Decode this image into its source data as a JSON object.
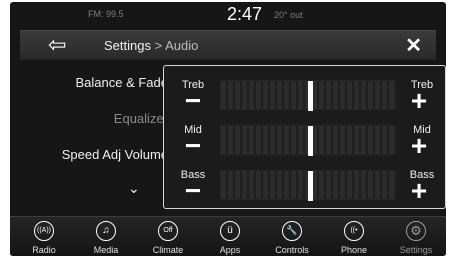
{
  "status": {
    "radio": "FM: 99.5",
    "time": "2:47",
    "temp": "20° out"
  },
  "header": {
    "back_icon": "back-arrow-icon",
    "title_section": "Settings",
    "title_sep": ">",
    "title_page": "Audio",
    "close_icon": "close-icon"
  },
  "menu": {
    "items": [
      {
        "label": "Balance & Fade",
        "active": true
      },
      {
        "label": "Equalizer",
        "active": false
      },
      {
        "label": "Speed Adj Volume",
        "active": true
      }
    ],
    "more_icon": "chevron-down-icon"
  },
  "equalizer": {
    "bands": [
      {
        "left_label": "Treb",
        "right_label": "Treb",
        "minus": "−",
        "plus": "+",
        "level": 0
      },
      {
        "left_label": "Mid",
        "right_label": "Mid",
        "minus": "−",
        "plus": "+",
        "level": 0
      },
      {
        "left_label": "Bass",
        "right_label": "Bass",
        "minus": "−",
        "plus": "+",
        "level": 0
      }
    ]
  },
  "navbar": {
    "items": [
      {
        "label": "Radio",
        "icon": "radio-icon",
        "glyph": "((A))"
      },
      {
        "label": "Media",
        "icon": "music-note-icon",
        "glyph": "♫"
      },
      {
        "label": "Climate",
        "icon": "climate-off-icon",
        "glyph": "Off"
      },
      {
        "label": "Apps",
        "icon": "apps-icon",
        "glyph": "ü"
      },
      {
        "label": "Controls",
        "icon": "wrench-icon",
        "glyph": "🔧"
      },
      {
        "label": "Phone",
        "icon": "phone-icon",
        "glyph": "((•"
      },
      {
        "label": "Settings",
        "icon": "gear-icon",
        "glyph": "⚙"
      }
    ],
    "active": "Settings"
  }
}
